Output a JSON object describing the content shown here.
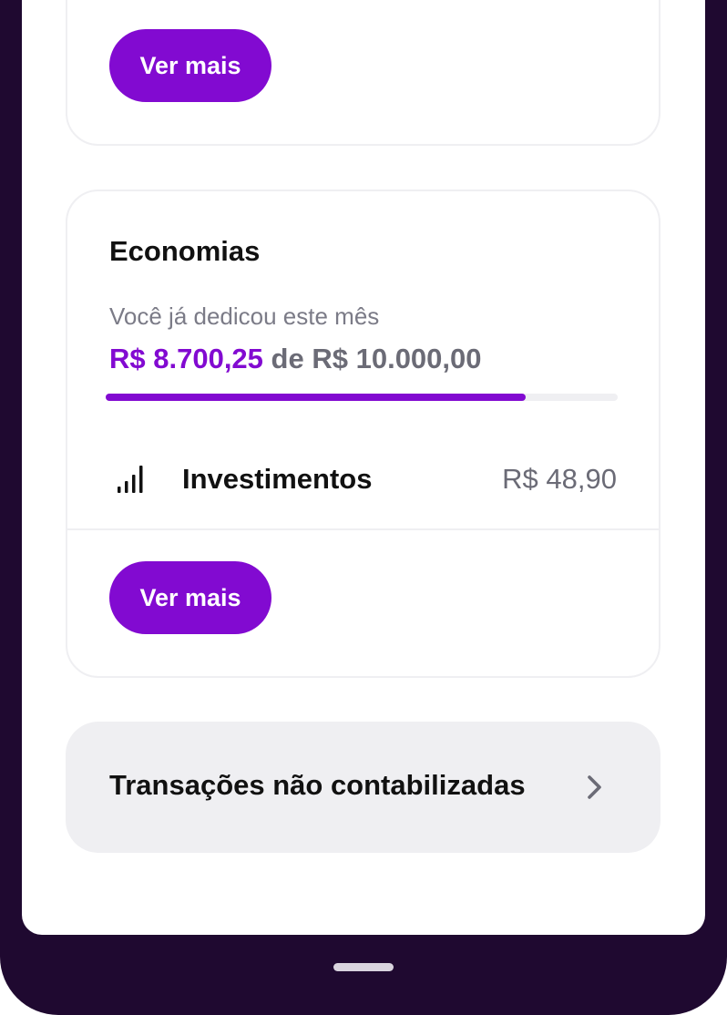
{
  "top_card": {
    "button_label": "Ver mais"
  },
  "economias": {
    "title": "Economias",
    "subtitle": "Você já dedicou este mês",
    "amount_saved": "R$ 8.700,25",
    "amount_connector": "de",
    "amount_goal": "R$ 10.000,00",
    "progress_fraction": 0.82,
    "row": {
      "icon": "signal-bars-icon",
      "label": "Investimentos",
      "value": "R$ 48,90"
    },
    "button_label": "Ver mais"
  },
  "transactions": {
    "label": "Transações não contabilizadas",
    "icon": "chevron-right-icon"
  },
  "colors": {
    "accent": "#820ad1",
    "device_frame": "#1f0930",
    "muted_text": "#6b6b76",
    "surface_gray": "#efeff2"
  }
}
